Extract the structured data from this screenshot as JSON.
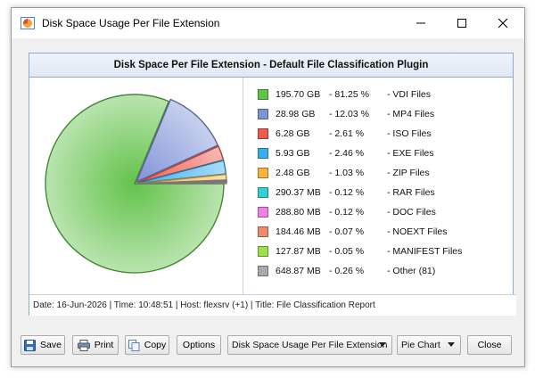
{
  "window": {
    "title": "Disk Space Usage Per File Extension"
  },
  "panel": {
    "header": "Disk Space Per File Extension - Default File Classification Plugin"
  },
  "footer_text": "Date: 16-Jun-2026 | Time: 10:48:51 | Host: flexsrv (+1) | Title: File Classification Report",
  "legend": [
    {
      "size": "195.70 GB",
      "pct": "- 81.25 %",
      "label": "- VDI Files",
      "color": "#63c24b"
    },
    {
      "size": "28.98 GB",
      "pct": "- 12.03 %",
      "label": "- MP4 Files",
      "color": "#7f92d6"
    },
    {
      "size": "6.28 GB",
      "pct": "- 2.61 %",
      "label": "- ISO Files",
      "color": "#ef5a4c"
    },
    {
      "size": "5.93 GB",
      "pct": "- 2.46 %",
      "label": "- EXE Files",
      "color": "#3aaef0"
    },
    {
      "size": "2.48 GB",
      "pct": "- 1.03 %",
      "label": "- ZIP Files",
      "color": "#f6b43f"
    },
    {
      "size": "290.37 MB",
      "pct": "- 0.12 %",
      "label": "- RAR Files",
      "color": "#36cfd0"
    },
    {
      "size": "288.80 MB",
      "pct": "- 0.12 %",
      "label": "- DOC Files",
      "color": "#f07fe6"
    },
    {
      "size": "184.46 MB",
      "pct": "- 0.07 %",
      "label": "- NOEXT Files",
      "color": "#f08a6a"
    },
    {
      "size": "127.87 MB",
      "pct": "- 0.05 %",
      "label": "- MANIFEST Files",
      "color": "#9ede48"
    },
    {
      "size": "648.87 MB",
      "pct": "- 0.26 %",
      "label": "- Other (81)",
      "color": "#a9a9a9"
    }
  ],
  "chart_data": {
    "type": "pie",
    "categories": [
      "VDI Files",
      "MP4 Files",
      "ISO Files",
      "EXE Files",
      "ZIP Files",
      "RAR Files",
      "DOC Files",
      "NOEXT Files",
      "MANIFEST Files",
      "Other (81)"
    ],
    "values": [
      81.25,
      12.03,
      2.61,
      2.46,
      1.03,
      0.12,
      0.12,
      0.07,
      0.05,
      0.26
    ],
    "colors": [
      "#63c24b",
      "#7f92d6",
      "#ef5a4c",
      "#3aaef0",
      "#f6b43f",
      "#36cfd0",
      "#f07fe6",
      "#f08a6a",
      "#9ede48",
      "#a9a9a9"
    ],
    "title": "Disk Space Per File Extension - Default File Classification Plugin",
    "legend": "right"
  },
  "buttons": {
    "save": "Save",
    "print": "Print",
    "copy": "Copy",
    "options": "Options",
    "close": "Close"
  },
  "selects": {
    "report": "Disk Space Usage Per File Extension",
    "chart_type": "Pie Chart"
  }
}
